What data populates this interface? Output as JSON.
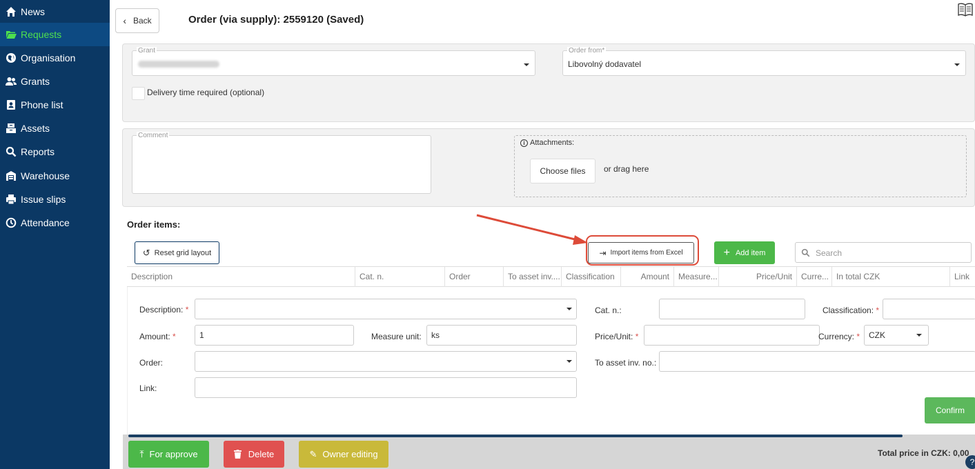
{
  "sidebar": {
    "items": [
      {
        "label": "News",
        "icon": "home-icon"
      },
      {
        "label": "Requests",
        "icon": "folder-open-icon"
      },
      {
        "label": "Organisation",
        "icon": "globe-icon"
      },
      {
        "label": "Grants",
        "icon": "users-icon"
      },
      {
        "label": "Phone list",
        "icon": "address-book-icon"
      },
      {
        "label": "Assets",
        "icon": "boxes-icon"
      },
      {
        "label": "Reports",
        "icon": "search-icon"
      },
      {
        "label": "Warehouse",
        "icon": "warehouse-icon"
      },
      {
        "label": "Issue slips",
        "icon": "print-icon"
      },
      {
        "label": "Attendance",
        "icon": "clock-icon"
      }
    ],
    "active": "Requests",
    "colors": {
      "background": "#0b3864",
      "active_text": "#4ee04e"
    }
  },
  "header": {
    "back_label": "Back",
    "title": "Order (via supply): 2559120 (Saved)"
  },
  "form": {
    "grant_legend": "Grant",
    "order_from_legend": "Order from*",
    "order_from_value": "Libovolný dodavatel",
    "delivery_label": "Delivery time required (optional)",
    "comment_legend": "Comment",
    "attachments_label": "Attachments:",
    "choose_files_label": "Choose files",
    "drag_label": "or drag here"
  },
  "order_items": {
    "heading": "Order items:",
    "reset_label": "Reset grid layout",
    "import_label": "Import items from Excel",
    "add_label": "Add item",
    "search_placeholder": "Search",
    "columns": [
      "Description",
      "Cat. n.",
      "Order",
      "To asset inv....",
      "Classification",
      "Amount",
      "Measure...",
      "Price/Unit",
      "Curre...",
      "In total CZK",
      "Link"
    ]
  },
  "editor": {
    "description_label": "Description:",
    "cat_label": "Cat. n.:",
    "classification_label": "Classification:",
    "amount_label": "Amount:",
    "amount_value": "1",
    "measure_label": "Measure unit:",
    "measure_value": "ks",
    "price_label": "Price/Unit:",
    "currency_label": "Currency:",
    "currency_value": "CZK",
    "order_label": "Order:",
    "asset_label": "To asset inv. no.:",
    "link_label": "Link:",
    "confirm_label": "Confirm"
  },
  "footer": {
    "approve_label": "For approve",
    "delete_label": "Delete",
    "owner_label": "Owner editing",
    "total_label": "Total price in CZK: 0,00",
    "colors": {
      "approve": "#4cb849",
      "delete": "#e05150",
      "owner": "#c9b93a"
    }
  },
  "annotation": {
    "highlight_color": "#dd4b39"
  }
}
